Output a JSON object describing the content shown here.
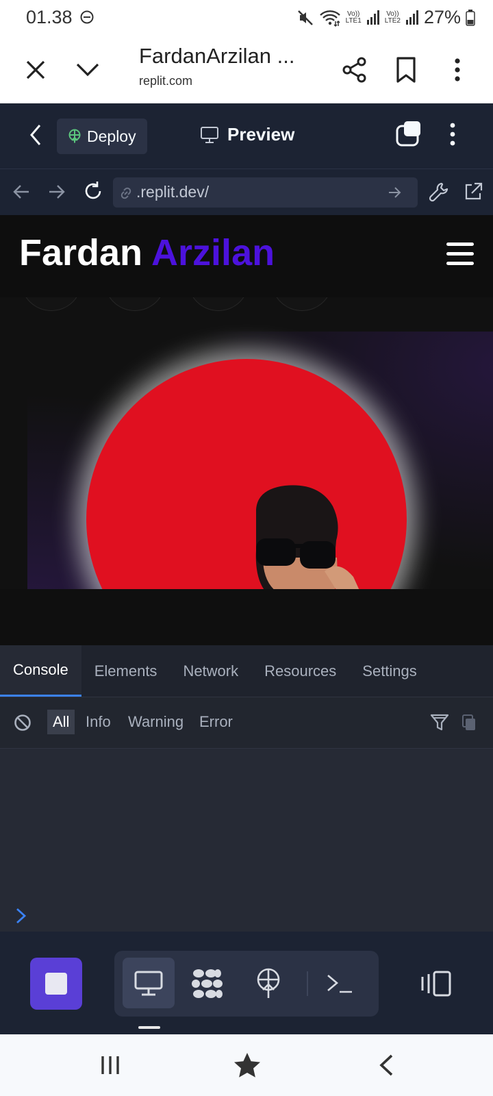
{
  "status_bar": {
    "time": "01.38",
    "battery": "27%",
    "sim1": "LTE1",
    "sim2": "LTE2",
    "volte": "Vo))"
  },
  "browser": {
    "title": "FardanArzilan ...",
    "domain": "replit.com"
  },
  "replit": {
    "deploy_label": "Deploy",
    "preview_label": "Preview",
    "url": ".replit.dev/"
  },
  "site": {
    "logo_first": "Fardan",
    "logo_second": "Arzilan"
  },
  "devtools": {
    "tabs": [
      "Console",
      "Elements",
      "Network",
      "Resources",
      "Settings"
    ],
    "active_tab": "Console",
    "levels": [
      "All",
      "Info",
      "Warning",
      "Error"
    ],
    "active_level": "All"
  },
  "colors": {
    "accent_purple": "#5a3fd6",
    "logo_accent": "#4c12dc",
    "hero_red": "#e01020",
    "dev_tab_highlight": "#3b82f6"
  },
  "icons": {
    "browser": [
      "close-icon",
      "chevron-down-icon",
      "share-icon",
      "bookmark-icon",
      "more-vert-icon"
    ],
    "replit_header": [
      "back-icon",
      "deploy-icon",
      "monitor-icon",
      "tabs-icon",
      "more-vert-icon"
    ],
    "url_bar": [
      "back-arrow-icon",
      "forward-arrow-icon",
      "reload-icon",
      "link-icon",
      "go-arrow-icon",
      "wrench-icon",
      "external-link-icon"
    ],
    "app_bar": [
      "stop-icon",
      "webview-icon",
      "agent-icon",
      "deploy-icon",
      "shell-icon",
      "split-view-icon"
    ],
    "nav": [
      "recents-icon",
      "home-star-icon",
      "nav-back-icon"
    ]
  }
}
